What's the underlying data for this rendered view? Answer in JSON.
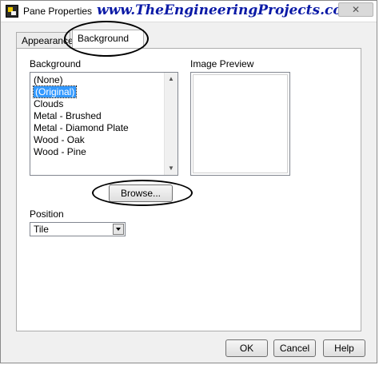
{
  "window": {
    "title": "Pane Properties",
    "watermark": "www.TheEngineeringProjects.com",
    "icons": {
      "app": "labview-app-icon",
      "close": "close-icon"
    }
  },
  "tabs": [
    {
      "label": "Appearance",
      "active": false
    },
    {
      "label": "Background",
      "active": true
    }
  ],
  "background_section": {
    "label": "Background",
    "items": [
      {
        "label": "(None)",
        "selected": false
      },
      {
        "label": "(Original)",
        "selected": true
      },
      {
        "label": "Clouds",
        "selected": false
      },
      {
        "label": "Metal - Brushed",
        "selected": false
      },
      {
        "label": "Metal - Diamond Plate",
        "selected": false
      },
      {
        "label": "Wood - Oak",
        "selected": false
      },
      {
        "label": "Wood - Pine",
        "selected": false
      }
    ]
  },
  "image_preview": {
    "label": "Image Preview"
  },
  "browse_button": {
    "label": "Browse..."
  },
  "position": {
    "label": "Position",
    "value": "Tile"
  },
  "footer": {
    "ok": "OK",
    "cancel": "Cancel",
    "help": "Help"
  },
  "colors": {
    "selection": "#3399ff",
    "watermark": "#0b1aa6",
    "annotation": "#000000"
  }
}
